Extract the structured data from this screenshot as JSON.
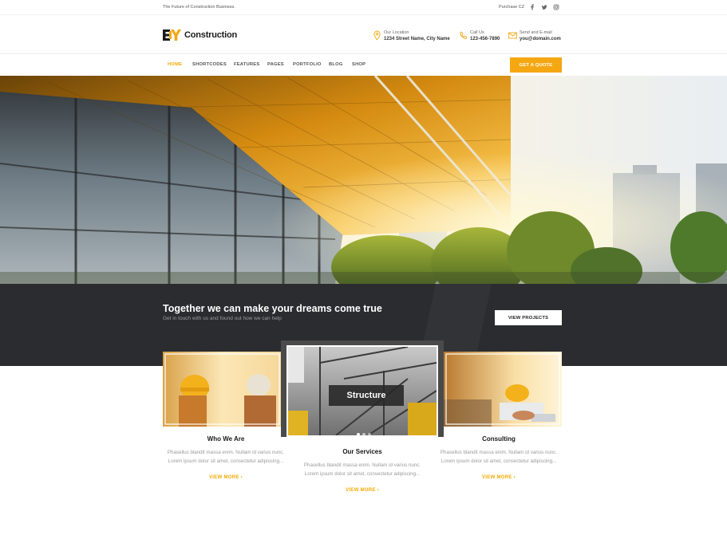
{
  "topbar": {
    "tagline": "The Future of Construction Business.",
    "purchase": "Purchase CZ",
    "social": [
      "facebook-icon",
      "twitter-icon",
      "instagram-icon"
    ]
  },
  "header": {
    "logo_text": "Construction",
    "location": {
      "label": "Our Location",
      "value": "1234 Street Name, City Name"
    },
    "call": {
      "label": "Call Us",
      "value": "123-456-7890"
    },
    "email": {
      "label": "Send and E-mail",
      "value": "you@domain.com"
    }
  },
  "nav": {
    "items": [
      "HOME",
      "SHORTCODES",
      "FEATURES",
      "PAGES",
      "PORTFOLIO",
      "BLOG",
      "SHOP"
    ],
    "active": "HOME",
    "quote_button": "GET A QUOTE"
  },
  "band": {
    "title": "Together we can make your dreams come true",
    "subtitle": "Get in touch with us and found out how we can help",
    "button": "VIEW PROJECTS"
  },
  "cards": [
    {
      "title": "Who We Are",
      "line1": "Phasellus blandit massa enim. Nullam id varius nunc.",
      "line2": "Lorem ipsum dolor sit amet, consectetur adipiscing...",
      "link": "VIEW MORE"
    },
    {
      "overlay": "Structure",
      "title": "Our Services",
      "line1": "Phasellus blandit massa enim. Nullam id varius nunc.",
      "line2": "Lorem ipsum dolor sit amet, consectetur adipiscing...",
      "link": "VIEW MORE"
    },
    {
      "title": "Consulting",
      "line1": "Phasellus blandit massa enim. Nullam id varius nunc.",
      "line2": "Lorem ipsum dolor sit amet, consectetur adipiscing...",
      "link": "VIEW MORE"
    }
  ],
  "colors": {
    "accent": "#f5a712",
    "dark": "#2b2c30"
  }
}
